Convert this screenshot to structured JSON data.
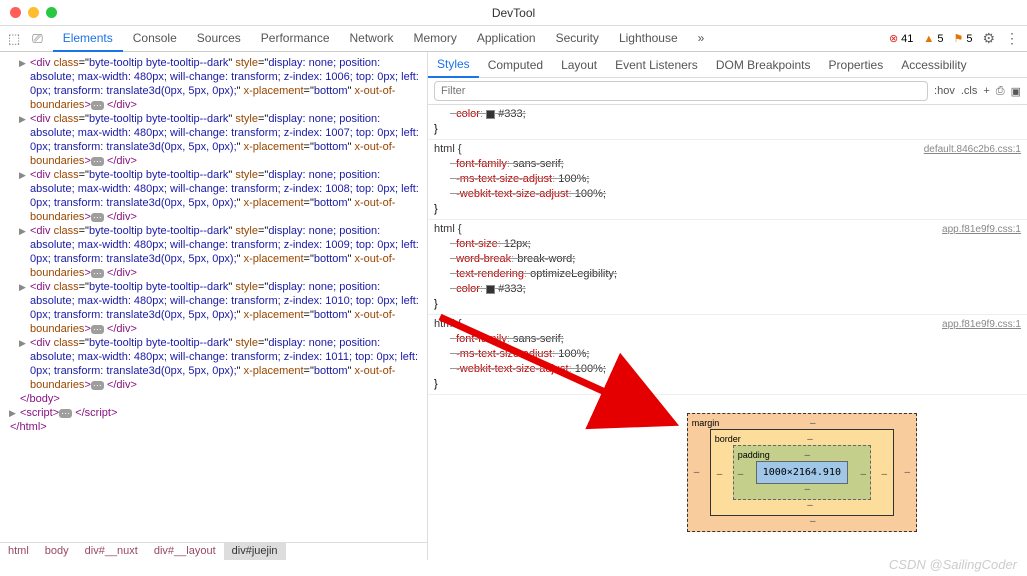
{
  "window": {
    "title": "DevTool"
  },
  "toolbar": {
    "tabs": [
      "Elements",
      "Console",
      "Sources",
      "Performance",
      "Network",
      "Memory",
      "Application",
      "Security",
      "Lighthouse"
    ],
    "active": 0,
    "errors": "41",
    "warnings": "5",
    "issues": "5"
  },
  "subtabs": {
    "items": [
      "Styles",
      "Computed",
      "Layout",
      "Event Listeners",
      "DOM Breakpoints",
      "Properties",
      "Accessibility"
    ],
    "active": 0
  },
  "filter": {
    "placeholder": "Filter",
    "hov": ":hov",
    "cls": ".cls"
  },
  "dom": {
    "class": "byte-tooltip byte-tooltip--dark",
    "style_prefix": "display: none; position: absolute; max-width: 480px; will-change: transform; z-index: ",
    "style_suffix": "; top: 0px; left: 0px; transform: translate3d(0px, 5px, 0px);",
    "xplace_attr": "x-placement",
    "xplace_val": "bottom",
    "xout_attr": "x-out-of-boundaries",
    "zindices": [
      "1006",
      "1007",
      "1008",
      "1009",
      "1010",
      "1011"
    ],
    "body_close": "</body>",
    "script_open": "<script>",
    "script_close": "</script>",
    "html_close": "</html>"
  },
  "breadcrumbs": [
    "html",
    "body",
    "div#__nuxt",
    "div#__layout",
    "div#juejin"
  ],
  "styles": {
    "r0": {
      "prop": "color",
      "val": "#333;"
    },
    "r1": {
      "sel": "html {",
      "src": "default.846c2b6.css:1",
      "p": [
        [
          "font-family",
          "sans-serif;"
        ],
        [
          "-ms-text-size-adjust",
          "100%;"
        ],
        [
          "-webkit-text-size-adjust",
          "100%;"
        ]
      ]
    },
    "r2": {
      "sel": "html {",
      "src": "app.f81e9f9.css:1",
      "p": [
        [
          "font-size",
          "12px;"
        ],
        [
          "word-break",
          "break-word;"
        ],
        [
          "text-rendering",
          "optimizeLegibility;"
        ],
        [
          "color",
          "#333;"
        ]
      ]
    },
    "r3": {
      "sel": "html {",
      "src": "app.f81e9f9.css:1",
      "p": [
        [
          "font-family",
          "sans-serif;"
        ],
        [
          "-ms-text-size-adjust",
          "100%;"
        ],
        [
          "-webkit-text-size-adjust",
          "100%;"
        ]
      ]
    }
  },
  "boxmodel": {
    "margin": "margin",
    "border": "border",
    "padding": "padding",
    "content": "1000×2164.910",
    "dash": "–"
  },
  "watermark": "CSDN @SailingCoder"
}
